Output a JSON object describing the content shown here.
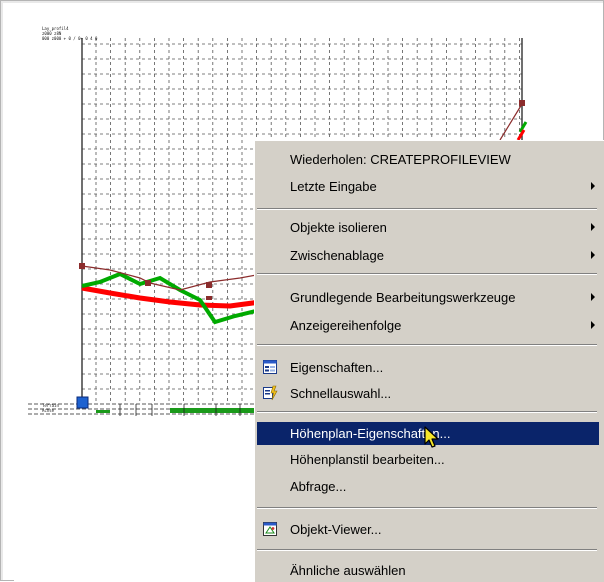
{
  "drawing": {
    "title_lines": [
      "Lay_profil4",
      "z000 z8N",
      "000 z000 + 0 / 0+ 0 4 0"
    ],
    "band_labels": [
      "Terrain",
      "Achse"
    ],
    "colors": {
      "grid": "#555555",
      "terrain_line": "#ff0000",
      "profile_line": "#00aa00",
      "axis_line": "#8b2c2c",
      "grip": "#1e62d0",
      "band_green": "#1a9a1a"
    }
  },
  "context_menu": {
    "items": [
      {
        "label": "Wiederholen: CREATEPROFILEVIEW",
        "submenu": false
      },
      {
        "label": "Letzte Eingabe",
        "submenu": true
      },
      {
        "label": "Objekte isolieren",
        "submenu": true
      },
      {
        "label": "Zwischenablage",
        "submenu": true
      },
      {
        "label": "Grundlegende Bearbeitungswerkzeuge",
        "submenu": true
      },
      {
        "label": "Anzeigereihenfolge",
        "submenu": true
      },
      {
        "label": "Eigenschaften...",
        "icon": "properties-icon"
      },
      {
        "label": "Schnellauswahl...",
        "icon": "quick-select-icon"
      },
      {
        "label": "Höhenplan-Eigenschaften...",
        "highlighted": true
      },
      {
        "label": "Höhenplanstil bearbeiten..."
      },
      {
        "label": "Abfrage..."
      },
      {
        "label": "Objekt-Viewer...",
        "icon": "object-viewer-icon"
      },
      {
        "label": "Ähnliche auswählen"
      }
    ],
    "colors": {
      "background": "#d4d0c8",
      "highlight": "#0a246a",
      "highlight_text": "#ffffff"
    }
  },
  "cursor": {
    "icon": "arrow-cursor-icon"
  }
}
